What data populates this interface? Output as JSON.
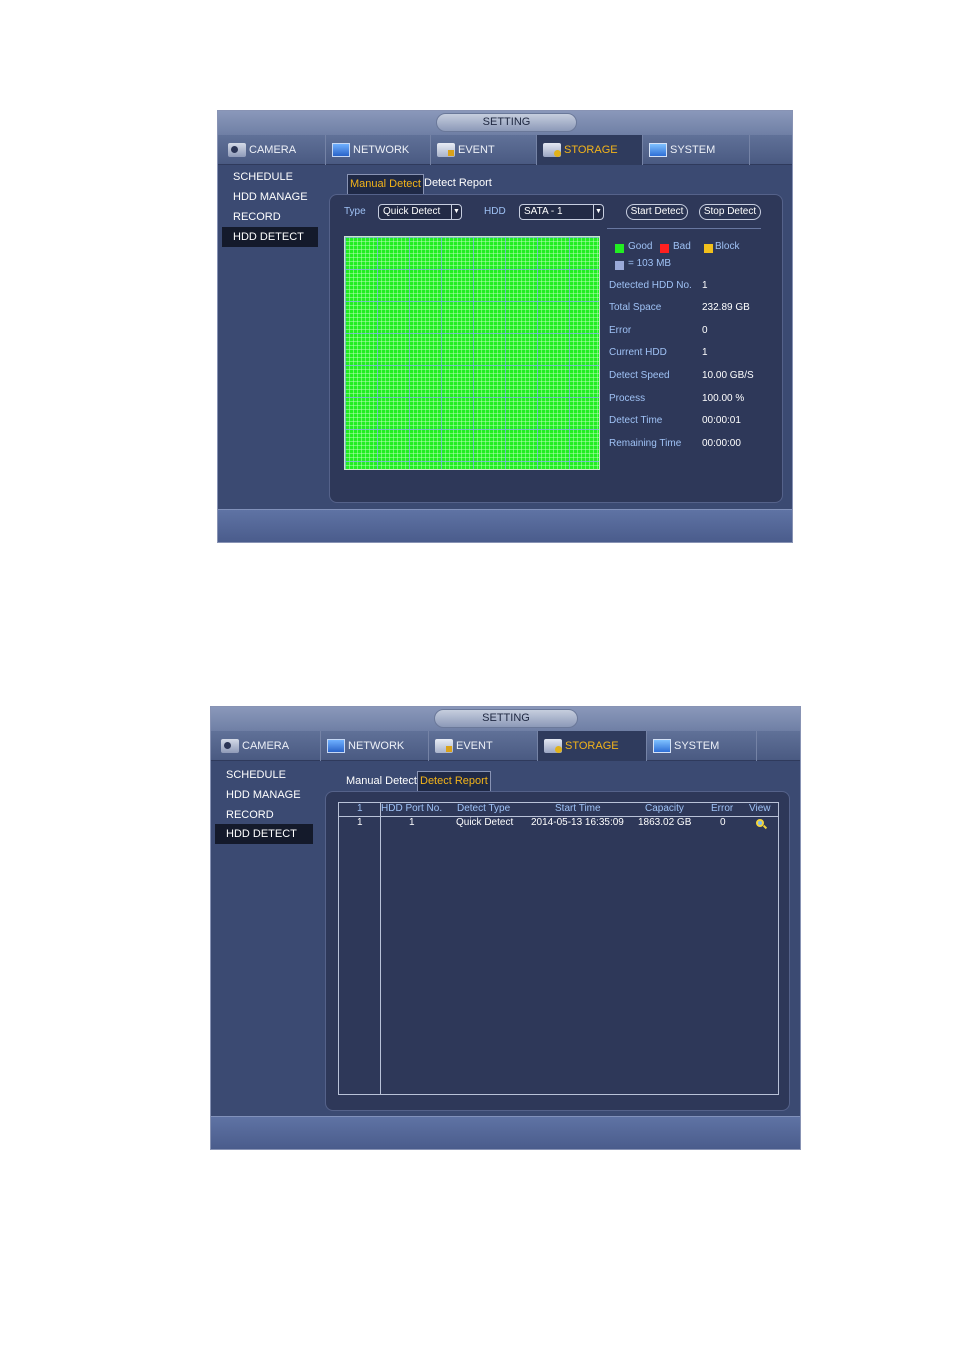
{
  "title": "SETTING",
  "tabs": {
    "camera": "CAMERA",
    "network": "NETWORK",
    "event": "EVENT",
    "storage": "STORAGE",
    "system": "SYSTEM"
  },
  "sidebar": [
    "SCHEDULE",
    "HDD MANAGE",
    "RECORD",
    "HDD DETECT"
  ],
  "subtabs": {
    "manual_detect": "Manual Detect",
    "detect_report": "Detect Report"
  },
  "manual_detect": {
    "type_label": "Type",
    "type_value": "Quick Detect",
    "hdd_label": "HDD",
    "hdd_value": "SATA - 1",
    "start_button": "Start Detect",
    "stop_button": "Stop Detect",
    "legend": {
      "good": "Good",
      "bad": "Bad",
      "block": "Block",
      "unit": "= 103 MB"
    },
    "colors": {
      "good": "#22ee22",
      "bad": "#ff2020",
      "block": "#f2c01c",
      "unit": "#9aa9d8"
    },
    "stats": [
      {
        "label": "Detected HDD No.",
        "value": "1"
      },
      {
        "label": "Total Space",
        "value": "232.89 GB"
      },
      {
        "label": "Error",
        "value": "0"
      },
      {
        "label": "Current HDD",
        "value": "1"
      },
      {
        "label": "Detect Speed",
        "value": "10.00 GB/S"
      },
      {
        "label": "Process",
        "value": "100.00 %"
      },
      {
        "label": "Detect Time",
        "value": "00:00:01"
      },
      {
        "label": "Remaining Time",
        "value": "00:00:00"
      }
    ]
  },
  "detect_report": {
    "header_index": "1",
    "columns": [
      "HDD Port No.",
      "Detect Type",
      "Start Time",
      "Capacity",
      "Error",
      "View"
    ],
    "rows": [
      {
        "index": "1",
        "port": "1",
        "type": "Quick Detect",
        "start_time": "2014-05-13 16:35:09",
        "capacity": "1863.02 GB",
        "error": "0",
        "view_icon": "magnifier-icon"
      }
    ]
  }
}
